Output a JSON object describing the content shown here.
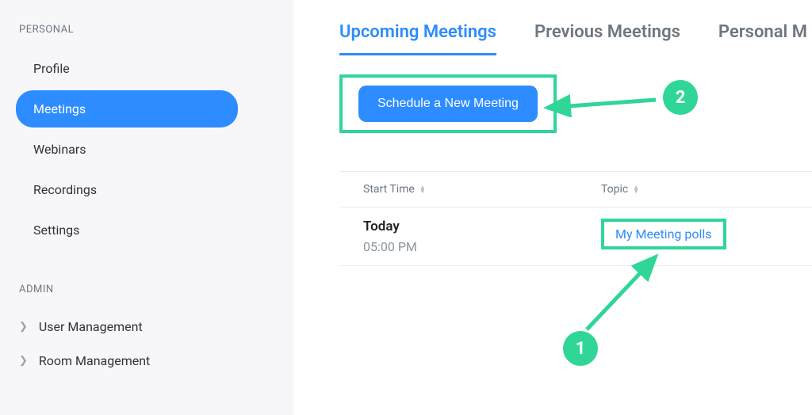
{
  "sidebar": {
    "personal_label": "PERSONAL",
    "items": {
      "profile": "Profile",
      "meetings": "Meetings",
      "webinars": "Webinars",
      "recordings": "Recordings",
      "settings": "Settings"
    },
    "admin_label": "ADMIN",
    "admin_items": {
      "user_management": "User Management",
      "room_management": "Room Management"
    }
  },
  "tabs": {
    "upcoming": "Upcoming Meetings",
    "previous": "Previous Meetings",
    "personal": "Personal M"
  },
  "schedule_button": "Schedule a New Meeting",
  "table": {
    "headers": {
      "start_time": "Start Time",
      "topic": "Topic"
    },
    "row": {
      "day": "Today",
      "time": "05:00 PM",
      "topic": "My Meeting polls"
    }
  },
  "annotations": {
    "badge1": "1",
    "badge2": "2"
  },
  "colors": {
    "primary": "#2d8cff",
    "highlight": "#2fd698"
  }
}
